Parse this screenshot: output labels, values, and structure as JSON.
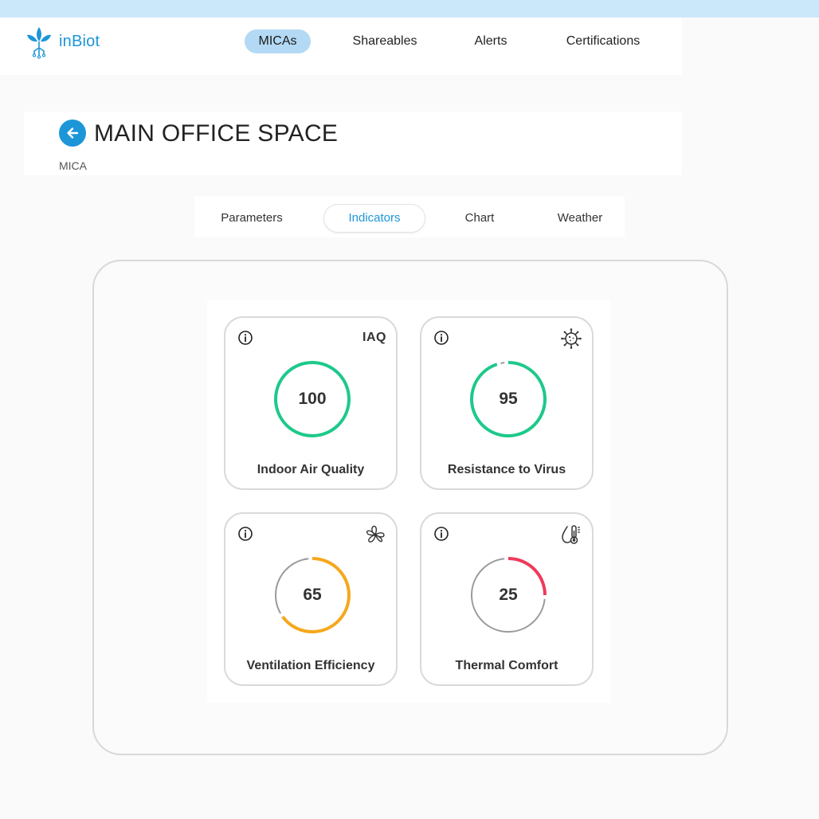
{
  "app": {
    "name": "inBiot"
  },
  "nav": {
    "items": [
      "MICAs",
      "Shareables",
      "Alerts",
      "Certifications"
    ],
    "active": "MICAs"
  },
  "header": {
    "title": "MAIN OFFICE SPACE",
    "subtitle": "MICA"
  },
  "tabs": {
    "items": [
      "Parameters",
      "Indicators",
      "Chart",
      "Weather"
    ],
    "active": "Indicators"
  },
  "indicators": [
    {
      "label": "Indoor Air Quality",
      "value": "100",
      "badge": "IAQ",
      "icon": "iaq-text",
      "percent": 100,
      "color": "#1dc98a"
    },
    {
      "label": "Resistance to Virus",
      "value": "95",
      "badge": "",
      "icon": "virus-icon",
      "percent": 95,
      "color": "#1dc98a"
    },
    {
      "label": "Ventilation Efficiency",
      "value": "65",
      "badge": "",
      "icon": "fan-icon",
      "percent": 65,
      "color": "#f5a81c"
    },
    {
      "label": "Thermal Comfort",
      "value": "25",
      "badge": "",
      "icon": "thermometer-drop-icon",
      "percent": 25,
      "color": "#ee3b5b"
    }
  ],
  "colors": {
    "brand": "#1d96d8",
    "nav_active_bg": "#b3d9f4",
    "gauge_track": "#9a9a9a"
  }
}
